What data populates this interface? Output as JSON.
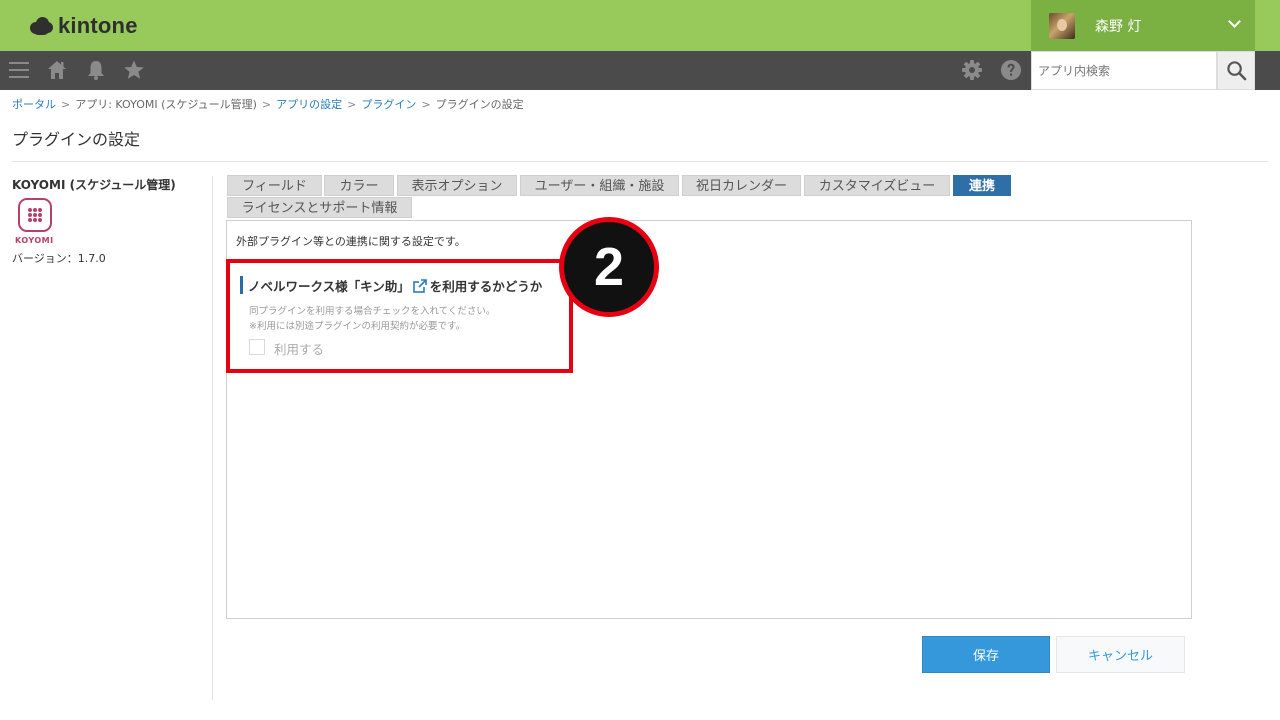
{
  "header": {
    "logo_text": "kintone",
    "user_name": "森野 灯",
    "search_placeholder": "アプリ内検索"
  },
  "icons": {
    "menu": "menu-icon",
    "home": "home-icon",
    "bell": "bell-icon",
    "star": "star-icon",
    "gear": "gear-icon",
    "help": "help-icon",
    "search": "search-icon",
    "chevron": "chevron-down-icon",
    "external_link": "external-link-icon"
  },
  "breadcrumb": {
    "portal": "ポータル",
    "app": "アプリ: KOYOMI (スケジュール管理)",
    "app_settings": "アプリの設定",
    "plugin": "プラグイン",
    "current": "プラグインの設定",
    "separator": ">"
  },
  "page_title": "プラグインの設定",
  "plugin": {
    "name": "KOYOMI (スケジュール管理)",
    "logo_text": "KOYOMI",
    "version": "バージョン：1.7.0"
  },
  "tabs": [
    {
      "label": "フィールド",
      "active": false
    },
    {
      "label": "カラー",
      "active": false
    },
    {
      "label": "表示オプション",
      "active": false
    },
    {
      "label": "ユーザー・組織・施設",
      "active": false
    },
    {
      "label": "祝日カレンダー",
      "active": false
    },
    {
      "label": "カスタマイズビュー",
      "active": false
    },
    {
      "label": "連携",
      "active": true
    },
    {
      "label": "ライセンスとサポート情報",
      "active": false
    }
  ],
  "panel": {
    "description": "外部プラグイン等との連携に関する設定です。",
    "section_title_prefix": "ノベルワークス様「キン助」",
    "section_title_suffix": "を利用するかどうか",
    "note_1": "同プラグインを利用する場合チェックを入れてください。",
    "note_2": "※利用には別途プラグインの利用契約が必要です。",
    "checkbox_label": "利用する"
  },
  "annotation": {
    "badge_number": "2"
  },
  "buttons": {
    "save": "保存",
    "cancel": "キャンセル"
  },
  "colors": {
    "header_green": "#98c95b",
    "toolbar_dark": "#4b4b4b",
    "active_tab": "#2f6fa8",
    "highlight_red": "#e60012",
    "save_blue": "#3498db",
    "link_blue": "#2b7bc0",
    "plugin_pink": "#b5406a"
  }
}
